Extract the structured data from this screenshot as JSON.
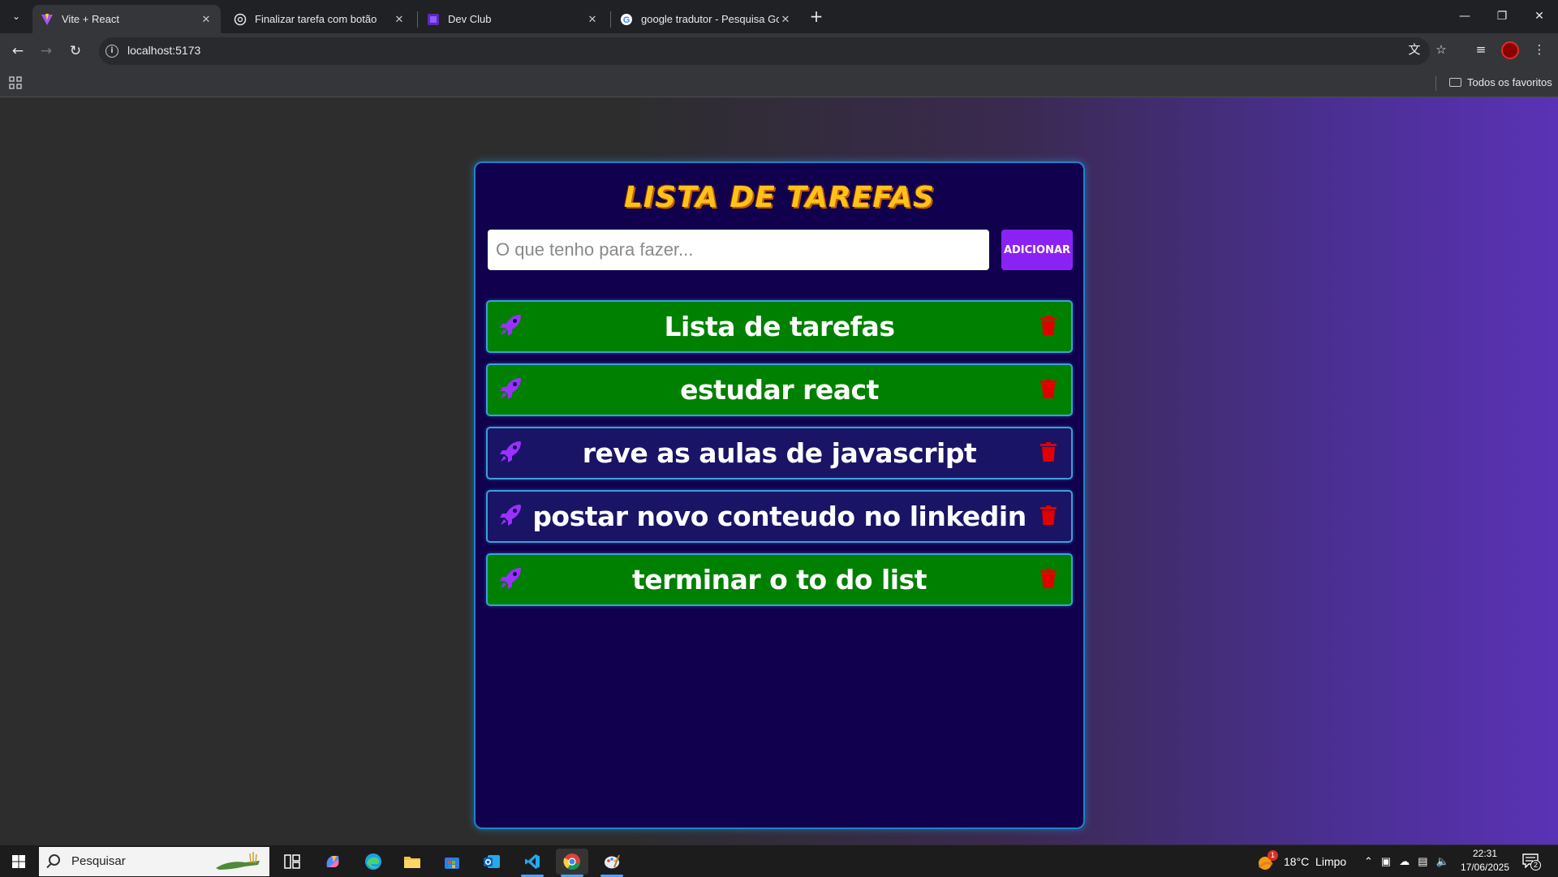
{
  "browser": {
    "tabs": [
      {
        "title": "Vite + React",
        "active": true,
        "favicon": "vite-icon"
      },
      {
        "title": "Finalizar tarefa com botão",
        "active": false,
        "favicon": "chatgpt-icon"
      },
      {
        "title": "Dev Club",
        "active": false,
        "favicon": "devclub-icon"
      },
      {
        "title": "google tradutor - Pesquisa Goo",
        "active": false,
        "favicon": "google-icon"
      }
    ],
    "url": "localhost:5173",
    "bookmarks_folder": "Todos os favoritos"
  },
  "app": {
    "title": "LISTA DE TAREFAS",
    "input_placeholder": "O que tenho para fazer...",
    "add_button": "ADICIONAR",
    "tasks": [
      {
        "text": "Lista de tarefas",
        "finished": true
      },
      {
        "text": "estudar react",
        "finished": true
      },
      {
        "text": "reve as aulas de javascript",
        "finished": false
      },
      {
        "text": "postar novo conteudo no linkedin",
        "finished": false
      },
      {
        "text": "terminar o to do list",
        "finished": true
      }
    ],
    "colors": {
      "done": "#008000",
      "todo": "#1a1466",
      "accent": "#8b22f5",
      "trash": "#e00000",
      "rocket": "#9b30ff"
    }
  },
  "taskbar": {
    "search_label": "Pesquisar",
    "weather": "18°C  Limpo",
    "weather_badge": "1",
    "time": "22:31",
    "date": "17/06/2025",
    "notifications": "2"
  }
}
